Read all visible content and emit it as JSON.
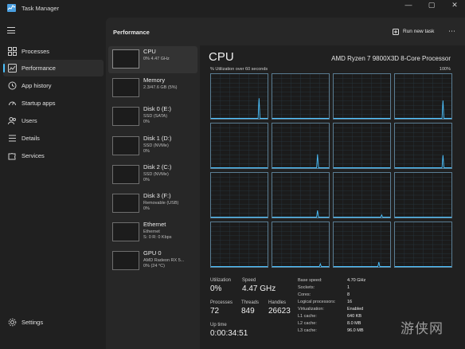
{
  "app": {
    "title": "Task Manager"
  },
  "window_controls": {
    "minimize": "—",
    "maximize": "▢",
    "close": "✕"
  },
  "sidebar": {
    "items": [
      {
        "label": "Processes",
        "icon": "processes-grid-icon"
      },
      {
        "label": "Performance",
        "icon": "performance-chart-icon",
        "active": true
      },
      {
        "label": "App history",
        "icon": "history-clock-icon"
      },
      {
        "label": "Startup apps",
        "icon": "startup-speedometer-icon"
      },
      {
        "label": "Users",
        "icon": "users-icon"
      },
      {
        "label": "Details",
        "icon": "details-list-icon"
      },
      {
        "label": "Services",
        "icon": "services-puzzle-icon"
      }
    ],
    "settings_label": "Settings"
  },
  "header": {
    "title": "Performance",
    "run_new_task": "Run new task"
  },
  "devices": [
    {
      "name": "CPU",
      "sub1": "0% 4.47 GHz",
      "sub2": "",
      "active": true
    },
    {
      "name": "Memory",
      "sub1": "2.3/47.6 GB (5%)",
      "sub2": ""
    },
    {
      "name": "Disk 0 (E:)",
      "sub1": "SSD (SATA)",
      "sub2": "0%"
    },
    {
      "name": "Disk 1 (D:)",
      "sub1": "SSD (NVMe)",
      "sub2": "0%"
    },
    {
      "name": "Disk 2 (C:)",
      "sub1": "SSD (NVMe)",
      "sub2": "0%"
    },
    {
      "name": "Disk 3 (F:)",
      "sub1": "Removable (USB)",
      "sub2": "0%"
    },
    {
      "name": "Ethernet",
      "sub1": "Ethernet",
      "sub2": "S: 0 R: 0 Kbps"
    },
    {
      "name": "GPU 0",
      "sub1": "AMD Radeon RX 5...",
      "sub2": "0% (24 °C)"
    }
  ],
  "cpu": {
    "title": "CPU",
    "model": "AMD Ryzen 7 9800X3D 8-Core Processor",
    "util_label": "% Utilization over 60 seconds",
    "util_max": "100%",
    "stats": {
      "utilization_label": "Utilization",
      "utilization": "0%",
      "speed_label": "Speed",
      "speed": "4.47 GHz",
      "processes_label": "Processes",
      "processes": "72",
      "threads_label": "Threads",
      "threads": "849",
      "handles_label": "Handles",
      "handles": "26623",
      "uptime_label": "Up time",
      "uptime": "0:00:34:51"
    },
    "specs": [
      {
        "label": "Base speed:",
        "value": "4.70 GHz"
      },
      {
        "label": "Sockets:",
        "value": "1"
      },
      {
        "label": "Cores:",
        "value": "8"
      },
      {
        "label": "Logical processors:",
        "value": "16"
      },
      {
        "label": "Virtualization:",
        "value": "Enabled"
      },
      {
        "label": "L1 cache:",
        "value": "640 KB"
      },
      {
        "label": "L2 cache:",
        "value": "8.0 MB"
      },
      {
        "label": "L3 cache:",
        "value": "96.0 MB"
      }
    ],
    "core_spikes": [
      [
        {
          "x": 0.85,
          "v": 0.45
        }
      ],
      [],
      [],
      [],
      [],
      [],
      [
        {
          "x": 0.85,
          "v": 0.4
        }
      ],
      [],
      [],
      [],
      [
        {
          "x": 0.8,
          "v": 0.3
        }
      ],
      [],
      [],
      [],
      [
        {
          "x": 0.85,
          "v": 0.28
        }
      ],
      [],
      [],
      [],
      [
        {
          "x": 0.8,
          "v": 0.15
        }
      ],
      [],
      [
        {
          "x": 0.85,
          "v": 0.05
        }
      ],
      [],
      [],
      [],
      [],
      [],
      [
        {
          "x": 0.85,
          "v": 0.06
        }
      ],
      [],
      [
        {
          "x": 0.8,
          "v": 0.1
        }
      ],
      [],
      [],
      []
    ],
    "line_color": "#4cc2ff"
  },
  "watermark": "游侠网"
}
